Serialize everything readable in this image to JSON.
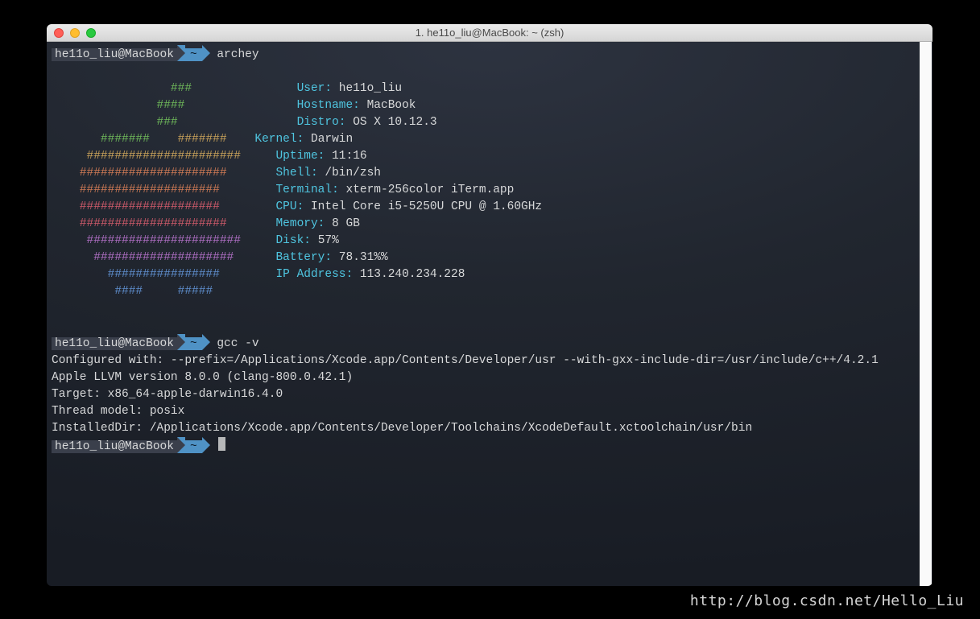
{
  "window_title": "1. he11o_liu@MacBook: ~ (zsh)",
  "prompt": {
    "user_host": "he11o_liu@MacBook",
    "dir": "~"
  },
  "cmd1": "archey",
  "cmd2": "gcc -v",
  "archey": {
    "logo": {
      "l1": "                 ###",
      "l2": "               ####",
      "l3": "               ###",
      "l4a": "       #######    ",
      "l4b": "#######",
      "l5": "     ######################",
      "l6": "    #####################",
      "l7": "    ####################",
      "l8": "    ####################",
      "l9": "    #####################",
      "l10": "     ######################",
      "l11": "      ####################",
      "l12": "        ################",
      "l13a": "         ####     ",
      "l13b": "#####"
    },
    "info": {
      "user_k": "User:",
      "user_v": "he11o_liu",
      "host_k": "Hostname:",
      "host_v": "MacBook",
      "distro_k": "Distro:",
      "distro_v": "OS X 10.12.3",
      "kernel_k": "Kernel:",
      "kernel_v": "Darwin",
      "uptime_k": "Uptime:",
      "uptime_v": "11:16",
      "shell_k": "Shell:",
      "shell_v": "/bin/zsh",
      "terminal_k": "Terminal:",
      "terminal_v": "xterm-256color iTerm.app",
      "cpu_k": "CPU:",
      "cpu_v": "Intel Core i5-5250U CPU @ 1.60GHz",
      "memory_k": "Memory:",
      "memory_v": "8 GB",
      "disk_k": "Disk:",
      "disk_v": "57%",
      "battery_k": "Battery:",
      "battery_v": "78.31%%",
      "ip_k": "IP Address:",
      "ip_v": "113.240.234.228"
    }
  },
  "gcc_output": {
    "l1": "Configured with: --prefix=/Applications/Xcode.app/Contents/Developer/usr --with-gxx-include-dir=/usr/include/c++/4.2.1",
    "l2": "Apple LLVM version 8.0.0 (clang-800.0.42.1)",
    "l3": "Target: x86_64-apple-darwin16.4.0",
    "l4": "Thread model: posix",
    "l5": "InstalledDir: /Applications/Xcode.app/Contents/Developer/Toolchains/XcodeDefault.xctoolchain/usr/bin"
  },
  "watermark": "http://blog.csdn.net/Hello_Liu"
}
